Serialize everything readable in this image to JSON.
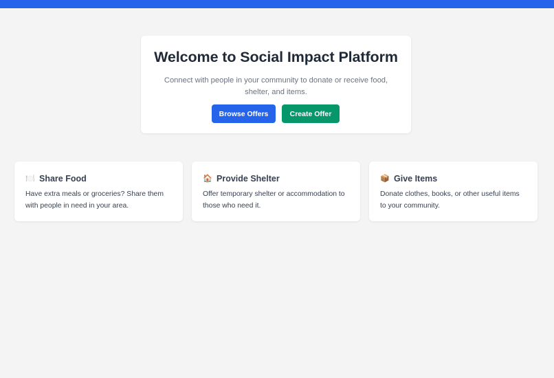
{
  "hero": {
    "title": "Welcome to Social Impact Platform",
    "subtitle": "Connect with people in your community to donate or receive food, shelter, and items.",
    "browse_label": "Browse Offers",
    "create_label": "Create Offer"
  },
  "cards": [
    {
      "icon": "🍽️",
      "icon_name": "plate-icon",
      "title": "Share Food",
      "text": "Have extra meals or groceries? Share them with people in need in your area."
    },
    {
      "icon": "🏠",
      "icon_name": "house-icon",
      "title": "Provide Shelter",
      "text": "Offer temporary shelter or accommodation to those who need it."
    },
    {
      "icon": "📦",
      "icon_name": "package-icon",
      "title": "Give Items",
      "text": "Donate clothes, books, or other useful items to your community."
    }
  ],
  "colors": {
    "accent": "#2563eb",
    "create": "#059669",
    "background": "#f4f4f5"
  }
}
